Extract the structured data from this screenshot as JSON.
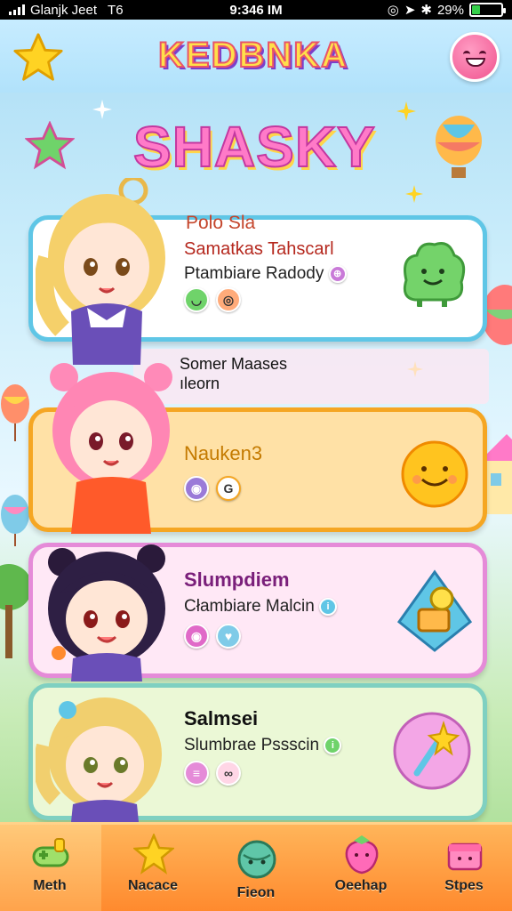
{
  "status_bar": {
    "carrier": "Glanjk Jeet",
    "network": "T6",
    "time": "9:346 IM",
    "battery_percent": "29%",
    "battery_level": 0.29
  },
  "header": {
    "logo_text": "KEDBNKA",
    "left_button_icon": "star-icon",
    "right_button_icon": "smiley-face-icon"
  },
  "title": "SHASKY",
  "cards": [
    {
      "header": "Polo Sla",
      "name": "Samatkas Tahscarl",
      "subtitle": "Ptambiare Radody",
      "theme_color": "#5fc6e6",
      "icon": "green-blob-icon"
    },
    {
      "name": "Nauken3",
      "badge_letter": "G",
      "theme_color": "#f5a623",
      "icon": "smiley-sun-icon"
    },
    {
      "name": "Slumpdiem",
      "subtitle": "Cłambiare Malcin",
      "theme_color": "#e58bd8",
      "icon": "key-crystal-icon"
    },
    {
      "name": "Salmsei",
      "subtitle": "Slumbrae Pssscin",
      "theme_color": "#7fd0c1",
      "icon": "magic-wand-icon"
    }
  ],
  "banner": {
    "line1": "Somer Maases",
    "line2": "ıleorn"
  },
  "nav": [
    {
      "label": "Meth",
      "icon": "gamepad-icon",
      "active": true
    },
    {
      "label": "Nacace",
      "icon": "star-icon"
    },
    {
      "label": "Fieon",
      "icon": "planet-icon"
    },
    {
      "label": "Oeehap",
      "icon": "strawberry-icon"
    },
    {
      "label": "Stpes",
      "icon": "gift-box-icon"
    }
  ],
  "colors": {
    "nav_bar": "#ff9a3c",
    "title_pink": "#ff7ac8",
    "logo_yellow": "#ffe04a"
  }
}
